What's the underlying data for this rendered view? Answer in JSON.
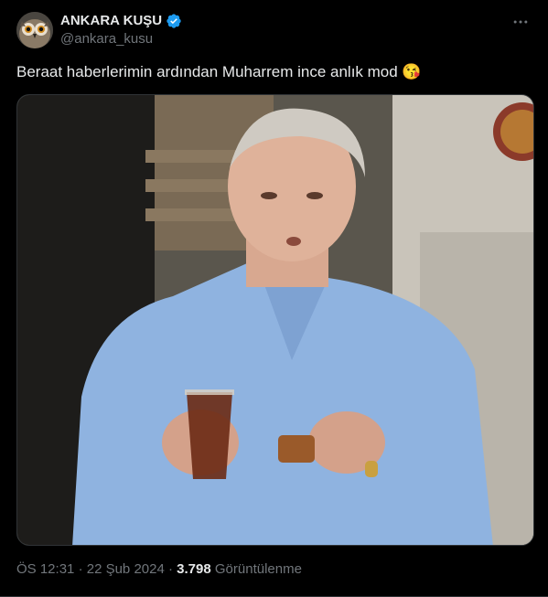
{
  "author": {
    "name": "ANKARA KUŞU",
    "handle": "@ankara_kusu",
    "verified": true,
    "verified_color": "#1d9bf0"
  },
  "post": {
    "text": "Beraat haberlerimin ardından Muharrem ince anlık mod 😘",
    "media_description_icon": "photo"
  },
  "meta": {
    "time": "ÖS 12:31",
    "separator": "·",
    "date": "22 Şub 2024",
    "views_count": "3.798",
    "views_label": "Görüntülenme"
  },
  "icons": {
    "more": "more-horizontal-icon",
    "verified": "verified-badge-icon"
  }
}
